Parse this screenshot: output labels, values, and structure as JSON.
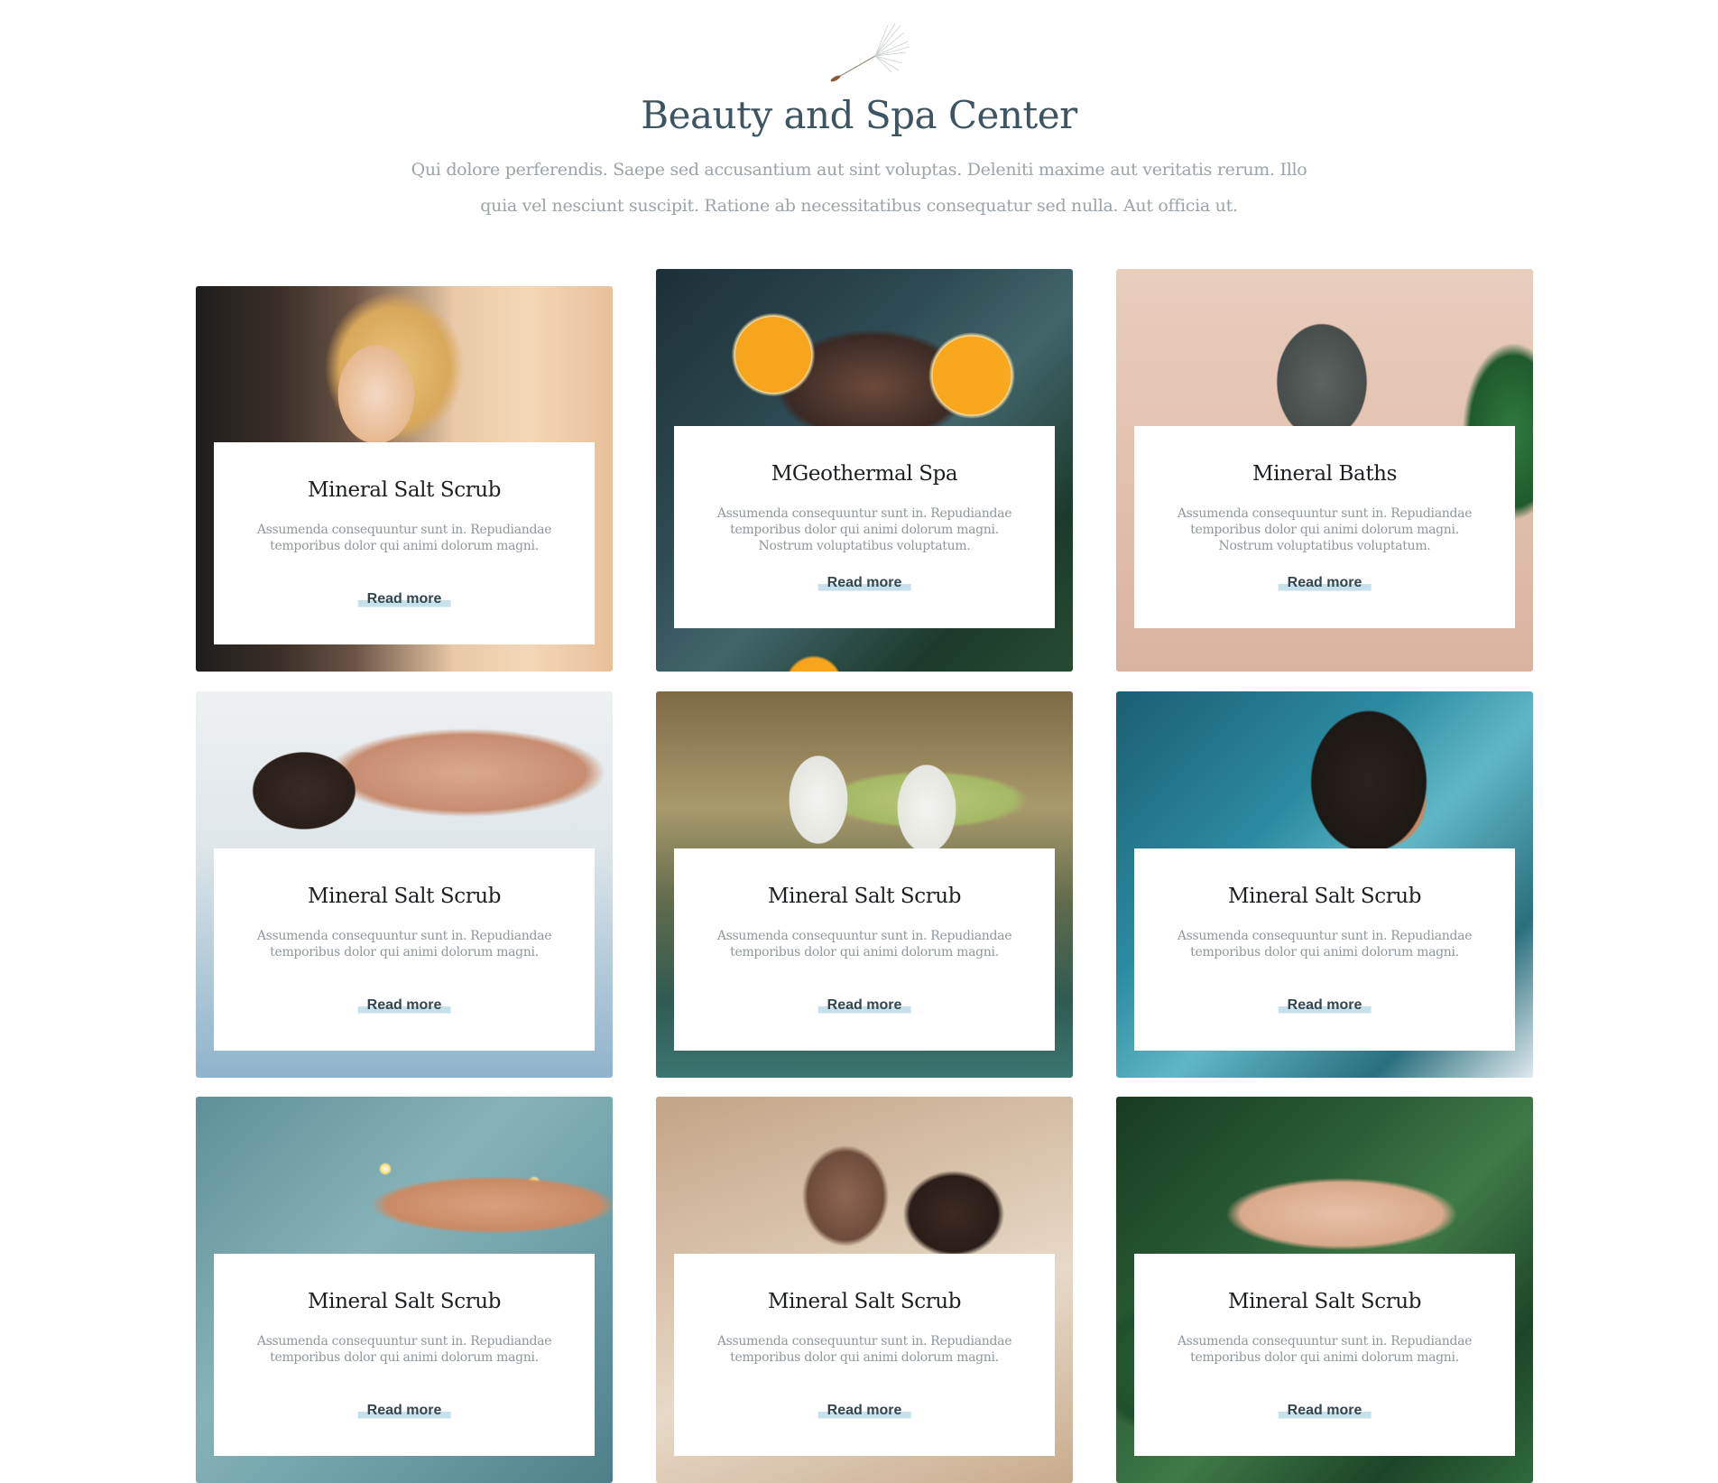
{
  "header": {
    "title": "Beauty and Spa Center",
    "subtitle": "Qui dolore perferendis. Saepe sed accusantium aut sint voluptas. Deleniti maxime aut veritatis rerum. Illo quia vel nesciunt suscipit. Ratione ab necessitatibus consequatur sed nulla. Aut officia ut.",
    "decoration_icon": "dandelion-seed-icon"
  },
  "colors": {
    "title": "#3e5561",
    "subtitle": "#9aa4aa",
    "card_title": "#1c1f22",
    "card_text": "#8e979c",
    "link_text": "#33464f",
    "link_highlight": "#c6e0ec"
  },
  "cards": [
    {
      "title": "Mineral Salt Scrub",
      "text": "Assumenda consequuntur sunt in. Repudiandae temporibus dolor qui animi dolorum magni.",
      "link": "Read more",
      "image": "woman-smiling-in-sauna-photo"
    },
    {
      "title": "MGeothermal Spa",
      "text": "Assumenda consequuntur sunt in. Repudiandae temporibus dolor qui animi dolorum magni. Nostrum voluptatibus voluptatum.",
      "link": "Read more",
      "image": "woman-in-water-with-orange-slices-photo"
    },
    {
      "title": "Mineral Baths",
      "text": "Assumenda consequuntur sunt in. Repudiandae temporibus dolor qui animi dolorum magni. Nostrum voluptatibus voluptatum.",
      "link": "Read more",
      "image": "woman-with-clay-face-mask-photo"
    },
    {
      "title": "Mineral Salt Scrub",
      "text": "Assumenda consequuntur sunt in. Repudiandae temporibus dolor qui animi dolorum magni.",
      "link": "Read more",
      "image": "back-massage-photo"
    },
    {
      "title": "Mineral Salt Scrub",
      "text": "Assumenda consequuntur sunt in. Repudiandae temporibus dolor qui animi dolorum magni.",
      "link": "Read more",
      "image": "women-in-robes-by-pool-photo"
    },
    {
      "title": "Mineral Salt Scrub",
      "text": "Assumenda consequuntur sunt in. Repudiandae temporibus dolor qui animi dolorum magni.",
      "link": "Read more",
      "image": "bearded-man-relaxing-photo"
    },
    {
      "title": "Mineral Salt Scrub",
      "text": "Assumenda consequuntur sunt in. Repudiandae temporibus dolor qui animi dolorum magni.",
      "link": "Read more",
      "image": "feet-in-pool-with-flowers-photo"
    },
    {
      "title": "Mineral Salt Scrub",
      "text": "Assumenda consequuntur sunt in. Repudiandae temporibus dolor qui animi dolorum magni.",
      "link": "Read more",
      "image": "couple-relaxing-in-spa-photo"
    },
    {
      "title": "Mineral Salt Scrub",
      "text": "Assumenda consequuntur sunt in. Repudiandae temporibus dolor qui animi dolorum magni.",
      "link": "Read more",
      "image": "hands-on-tropical-leaves-photo"
    }
  ]
}
